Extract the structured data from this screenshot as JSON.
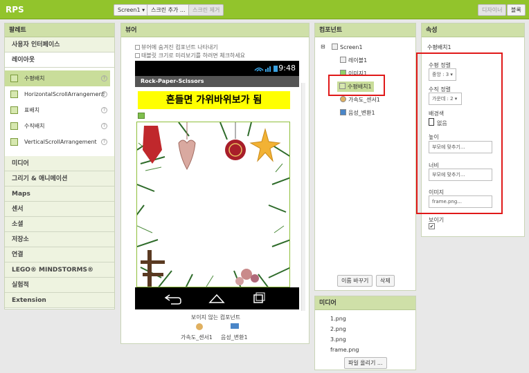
{
  "app": {
    "title": "RPS"
  },
  "toolbar": {
    "screen_selector": "Screen1 ▾",
    "add_screen": "스크린 추가 ...",
    "remove_screen": "스크린 제거",
    "designer": "디자이너",
    "blocks": "블록"
  },
  "palette": {
    "title": "팔레트",
    "categories_top": [
      "사용자 인터페이스",
      "레이아웃"
    ],
    "layout_items": [
      {
        "label": "수평배치",
        "selected": true
      },
      {
        "label": "HorizontalScrollArrangement",
        "selected": false
      },
      {
        "label": "표배치",
        "selected": false
      },
      {
        "label": "수직배치",
        "selected": false
      },
      {
        "label": "VerticalScrollArrangement",
        "selected": false
      }
    ],
    "categories_bottom": [
      "미디어",
      "그리기 & 애니메이션",
      "Maps",
      "센서",
      "소셜",
      "저장소",
      "연결",
      "LEGO® MINDSTORMS®",
      "실험적",
      "Extension"
    ]
  },
  "viewer": {
    "title": "뷰어",
    "show_hidden": "뷰어에 숨겨진 컴포넌트 나타내기",
    "tablet_preview": "태블릿 크기로 미리보기를 하려면 체크하세요",
    "clock": "9:48",
    "app_name": "Rock-Paper-Scissors",
    "banner_text": "흔들면 가위바위보가 됨",
    "nonvisible_title": "보이지 않는 컴포넌트",
    "nonvisible": [
      "가속도_센서1",
      "음성_변환1"
    ]
  },
  "components": {
    "title": "컴포넌트",
    "tree": [
      "Screen1",
      "레이블1",
      "이미지1",
      "수평배치1",
      "가속도_센서1",
      "음성_변환1"
    ],
    "rename": "이름 바꾸기",
    "delete": "삭제"
  },
  "media": {
    "title": "미디어",
    "files": [
      "1.png",
      "2.png",
      "3.png",
      "frame.png"
    ],
    "upload": "파일 올리기 ..."
  },
  "properties": {
    "title": "속성",
    "component": "수평배치1",
    "align_h_label": "수평 정렬",
    "align_h_value": "중앙 : 3 ▾",
    "align_v_label": "수직 정렬",
    "align_v_value": "가운데 : 2 ▾",
    "bg_label": "배경색",
    "bg_value": "없음",
    "height_label": "높이",
    "height_value": "부모에 맞추기...",
    "width_label": "너비",
    "width_value": "부모에 맞추기...",
    "image_label": "이미지",
    "image_value": "frame.png...",
    "visible_label": "보이기",
    "visible_value": "✔"
  },
  "colors": {
    "topbar": "#92c42c",
    "highlight": "#e01818",
    "banner": "#ffff00"
  }
}
